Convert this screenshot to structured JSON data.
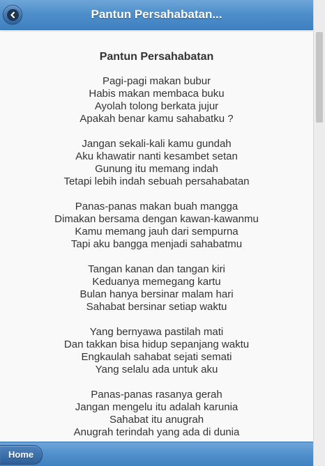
{
  "header": {
    "title": "Pantun Persahabatan...",
    "back_icon": "chevron-left-icon"
  },
  "poem": {
    "title": "Pantun Persahabatan",
    "stanzas": [
      [
        "Pagi-pagi makan bubur",
        "Habis makan membaca buku",
        "Ayolah tolong berkata jujur",
        "Apakah benar kamu sahabatku ?"
      ],
      [
        "Jangan sekali-kali kamu gundah",
        "Aku khawatir nanti kesambet setan",
        "Gunung itu memang indah",
        "Tetapi lebih indah sebuah persahabatan"
      ],
      [
        "Panas-panas makan buah mangga",
        "Dimakan bersama dengan kawan-kawanmu",
        "Kamu memang jauh dari sempurna",
        "Tapi aku bangga menjadi sahabatmu"
      ],
      [
        "Tangan kanan dan tangan kiri",
        "Keduanya memegang kartu",
        "Bulan hanya bersinar malam hari",
        "Sahabat bersinar setiap waktu"
      ],
      [
        "Yang bernyawa pastilah mati",
        "Dan takkan bisa hidup sepanjang waktu",
        "Engkaulah sahabat sejati semati",
        "Yang selalu ada untuk aku"
      ],
      [
        "Panas-panas rasanya gerah",
        "Jangan mengelu itu adalah karunia",
        "Sahabat itu anugrah",
        "Anugrah terindah yang ada di dunia"
      ]
    ]
  },
  "footer": {
    "home_label": "Home"
  },
  "colors": {
    "header_bar": "#4f8fcb",
    "text": "#333333",
    "background": "#f9f9f9"
  }
}
